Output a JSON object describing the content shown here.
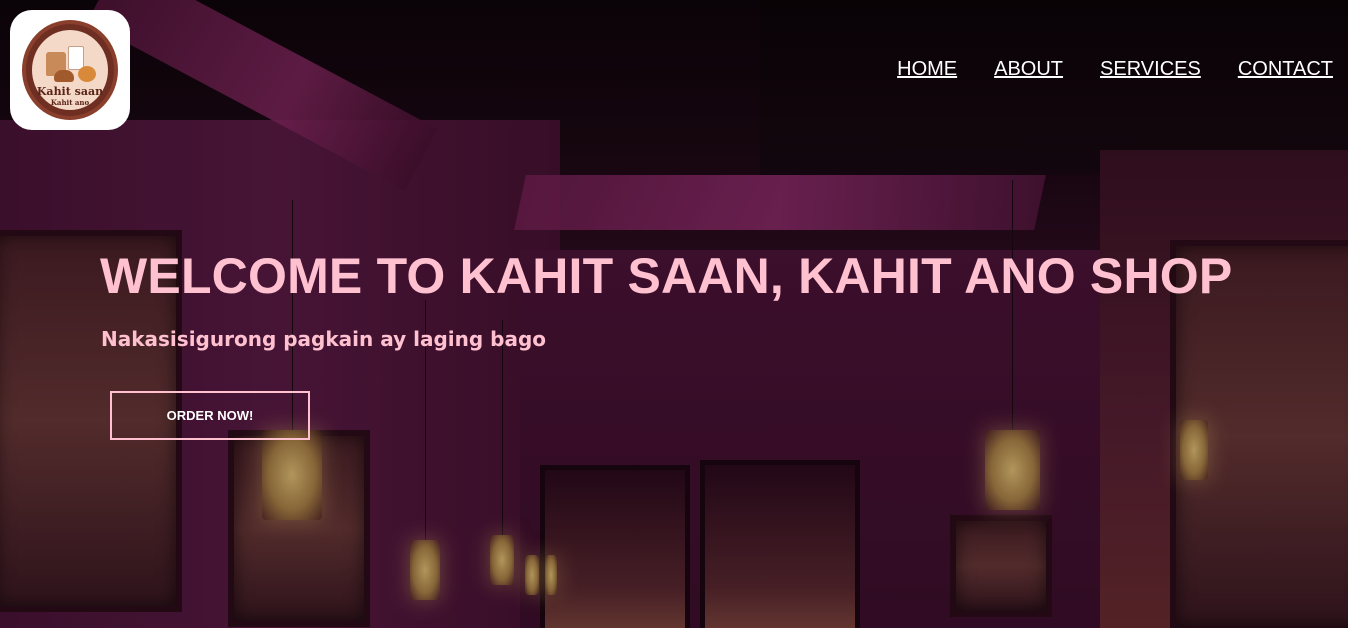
{
  "logo": {
    "name": "Kahit saan",
    "tagline": "Kahit ano"
  },
  "nav": {
    "items": [
      {
        "label": "HOME"
      },
      {
        "label": "ABOUT"
      },
      {
        "label": "SERVICES"
      },
      {
        "label": "CONTACT"
      }
    ]
  },
  "hero": {
    "title": "WELCOME TO KAHIT SAAN, KAHIT ANO SHOP",
    "subtitle": "Nakasisigurong pagkain ay laging bago",
    "cta_label": "ORDER NOW!"
  },
  "colors": {
    "accent_pink": "#ffc0d0",
    "nav_text": "#ffffff",
    "background_tint": "#3a0f2a"
  }
}
